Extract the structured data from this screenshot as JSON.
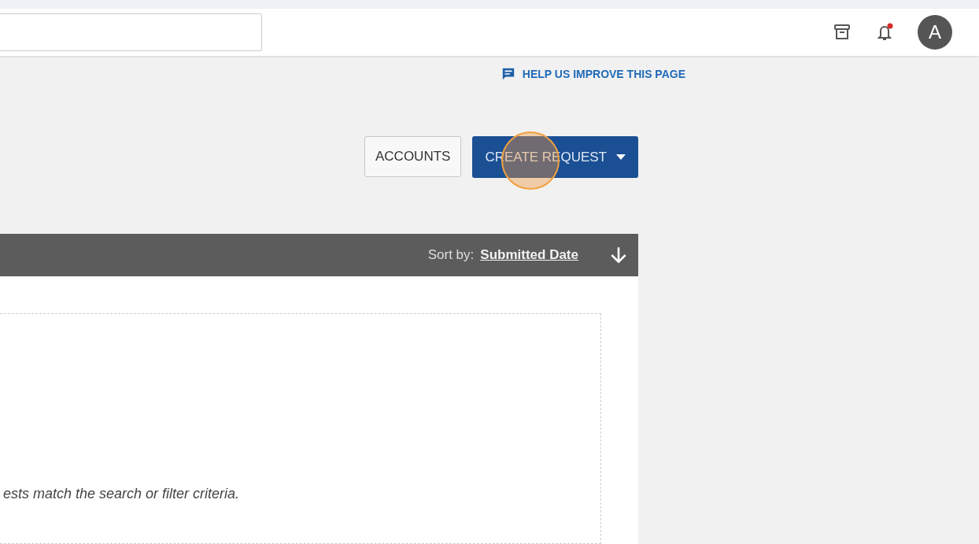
{
  "header": {
    "avatar": "A",
    "notifications": {
      "unread": true
    }
  },
  "help_link": "HELP US IMPROVE THIS PAGE",
  "actions": [
    {
      "kind": "outline",
      "label": "ACCOUNTS"
    },
    {
      "kind": "dropdown",
      "label": "CREATE REQUEST",
      "highlighted": true
    }
  ],
  "list_bar": {
    "sort_label": "Sort by:",
    "sort_field": "Submitted Date"
  },
  "empty_message": "ests match the search or filter criteria."
}
